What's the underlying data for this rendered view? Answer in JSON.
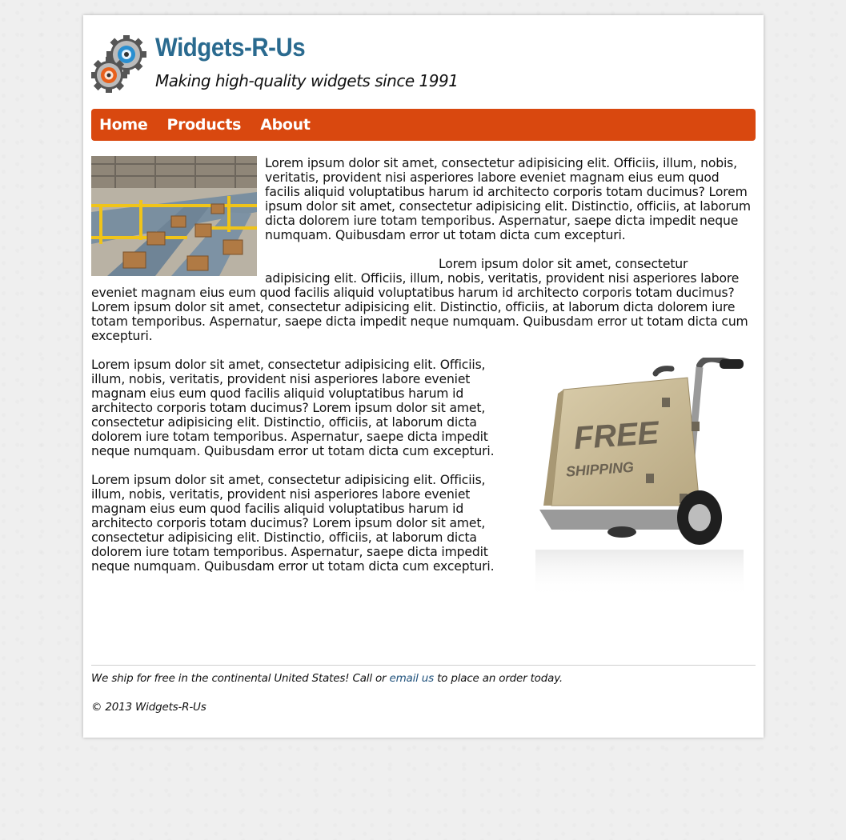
{
  "header": {
    "title": "Widgets-R-Us",
    "tagline": "Making high-quality widgets since 1991",
    "logo_icon": "gears-icon"
  },
  "nav": {
    "items": [
      {
        "label": "Home"
      },
      {
        "label": "Products"
      },
      {
        "label": "About"
      }
    ],
    "color": "#d9480f"
  },
  "main": {
    "paragraphs": [
      "Lorem ipsum dolor sit amet, consectetur adipisicing elit. Officiis, illum, nobis, veritatis, provident nisi asperiores labore eveniet magnam eius eum quod facilis aliquid voluptatibus harum id architecto corporis totam ducimus? Lorem ipsum dolor sit amet, consectetur adipisicing elit. Distinctio, officiis, at laborum dicta dolorem iure totam temporibus. Aspernatur, saepe dicta impedit neque numquam. Quibusdam error ut totam dicta cum excepturi.",
      "Lorem ipsum dolor sit amet, consectetur adipisicing elit. Officiis, illum, nobis, veritatis, provident nisi asperiores labore eveniet magnam eius eum quod facilis aliquid voluptatibus harum id architecto corporis totam ducimus? Lorem ipsum dolor sit amet, consectetur adipisicing elit. Distinctio, officiis, at laborum dicta dolorem iure totam temporibus. Aspernatur, saepe dicta impedit neque numquam. Quibusdam error ut totam dicta cum excepturi.",
      "Lorem ipsum dolor sit amet, consectetur adipisicing elit. Officiis, illum, nobis, veritatis, provident nisi asperiores labore eveniet magnam eius eum quod facilis aliquid voluptatibus harum id architecto corporis totam ducimus? Lorem ipsum dolor sit amet, consectetur adipisicing elit. Distinctio, officiis, at laborum dicta dolorem iure totam temporibus. Aspernatur, saepe dicta impedit neque numquam. Quibusdam error ut totam dicta cum excepturi.",
      "Lorem ipsum dolor sit amet, consectetur adipisicing elit. Officiis, illum, nobis, veritatis, provident nisi asperiores labore eveniet magnam eius eum quod facilis aliquid voluptatibus harum id architecto corporis totam ducimus? Lorem ipsum dolor sit amet, consectetur adipisicing elit. Distinctio, officiis, at laborum dicta dolorem iure totam temporibus. Aspernatur, saepe dicta impedit neque numquam. Quibusdam error ut totam dicta cum excepturi."
    ],
    "factory_image_icon": "factory-conveyor-image",
    "cart_image": {
      "icon": "hand-truck-box-image",
      "line1": "FREE",
      "line2": "SHIPPING"
    }
  },
  "footer": {
    "ship_prefix": "We ship for free in the continental United States! Call or ",
    "email_link": "email us",
    "ship_suffix": " to place an order today.",
    "copyright": "© 2013 Widgets-R-Us"
  }
}
